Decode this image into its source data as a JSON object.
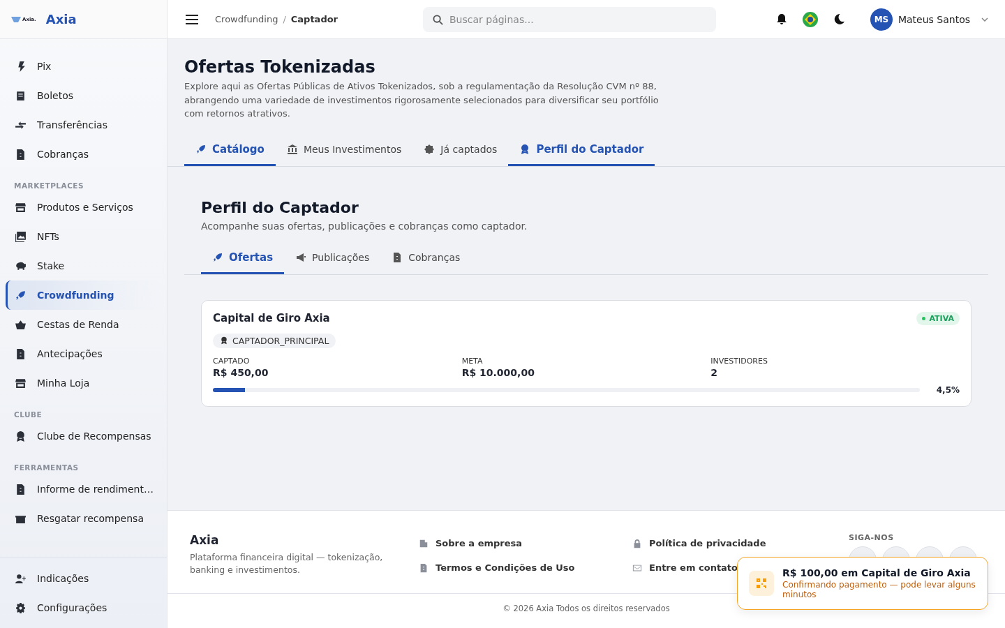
{
  "brand": {
    "name": "Axia",
    "logo_text": "Axia."
  },
  "sidebar": {
    "sections": [
      {
        "items": [
          {
            "label": "Pix",
            "selected": false
          },
          {
            "label": "Boletos",
            "selected": false
          },
          {
            "label": "Transferências",
            "selected": false
          },
          {
            "label": "Cobranças",
            "selected": false
          }
        ]
      },
      {
        "title": "MARKETPLACES",
        "items": [
          {
            "label": "Produtos e Serviços",
            "selected": false
          },
          {
            "label": "NFTs",
            "selected": false
          },
          {
            "label": "Stake",
            "selected": false
          },
          {
            "label": "Crowdfunding",
            "selected": true
          },
          {
            "label": "Cestas de Renda",
            "selected": false
          },
          {
            "label": "Antecipações",
            "selected": false
          },
          {
            "label": "Minha Loja",
            "selected": false
          }
        ]
      },
      {
        "title": "CLUBE",
        "items": [
          {
            "label": "Clube de Recompensas",
            "selected": false
          }
        ]
      },
      {
        "title": "FERRAMENTAS",
        "items": [
          {
            "label": "Informe de rendiment…",
            "selected": false
          },
          {
            "label": "Resgatar recompensa",
            "selected": false
          }
        ]
      }
    ],
    "bottom_items": [
      {
        "label": "Indicações",
        "selected": false
      },
      {
        "label": "Configurações",
        "selected": false
      }
    ]
  },
  "header": {
    "breadcrumb": [
      "Crowdfunding",
      "Captador"
    ],
    "breadcrumb_separator": "/",
    "search": {
      "placeholder": "Buscar páginas..."
    },
    "user": {
      "initials": "MS",
      "name": "Mateus Santos"
    }
  },
  "page": {
    "title": "Ofertas Tokenizadas",
    "description": "Explore aqui as Ofertas Públicas de Ativos Tokenizados, sob a regulamentação da Resolução CVM nº 88, abrangendo uma variedade de investimentos rigorosamente selecionados para diversificar seu portfólio com retornos atrativos.",
    "tabs": [
      {
        "label": "Catálogo",
        "selected": true
      },
      {
        "label": "Meus Investimentos",
        "selected": false
      },
      {
        "label": "Já captados",
        "selected": false
      },
      {
        "label": "Perfil do Captador",
        "selected": true
      }
    ]
  },
  "section": {
    "title": "Perfil do Captador",
    "subtitle": "Acompanhe suas ofertas, publicações e cobranças como captador.",
    "tabs": [
      {
        "label": "Ofertas",
        "selected": true
      },
      {
        "label": "Publicações",
        "selected": false
      },
      {
        "label": "Cobranças",
        "selected": false
      }
    ]
  },
  "offers": [
    {
      "name": "Capital de Giro Axia",
      "status": "ATIVA",
      "role": "CAPTADOR_PRINCIPAL",
      "stats": [
        {
          "label": "CAPTADO",
          "value": "R$ 450,00"
        },
        {
          "label": "META",
          "value": "R$ 10.000,00"
        },
        {
          "label": "INVESTIDORES",
          "value": "2"
        }
      ],
      "level": 0.045,
      "percent": "4,5%"
    }
  ],
  "footer": {
    "brand": "Axia",
    "tagline": "Plataforma financeira digital — tokenização, banking e investimentos.",
    "links": [
      "Sobre a empresa",
      "Política de privacidade",
      "Termos e Condições de Uso",
      "Entre em contato"
    ],
    "social_title": "SIGA-NOS",
    "copyright": "© 2026 Axia Todos os direitos reservados"
  },
  "toast": {
    "title": "R$ 100,00 em Capital de Giro Axia",
    "message": "Confirmando pagamento — pode levar alguns minutos"
  }
}
